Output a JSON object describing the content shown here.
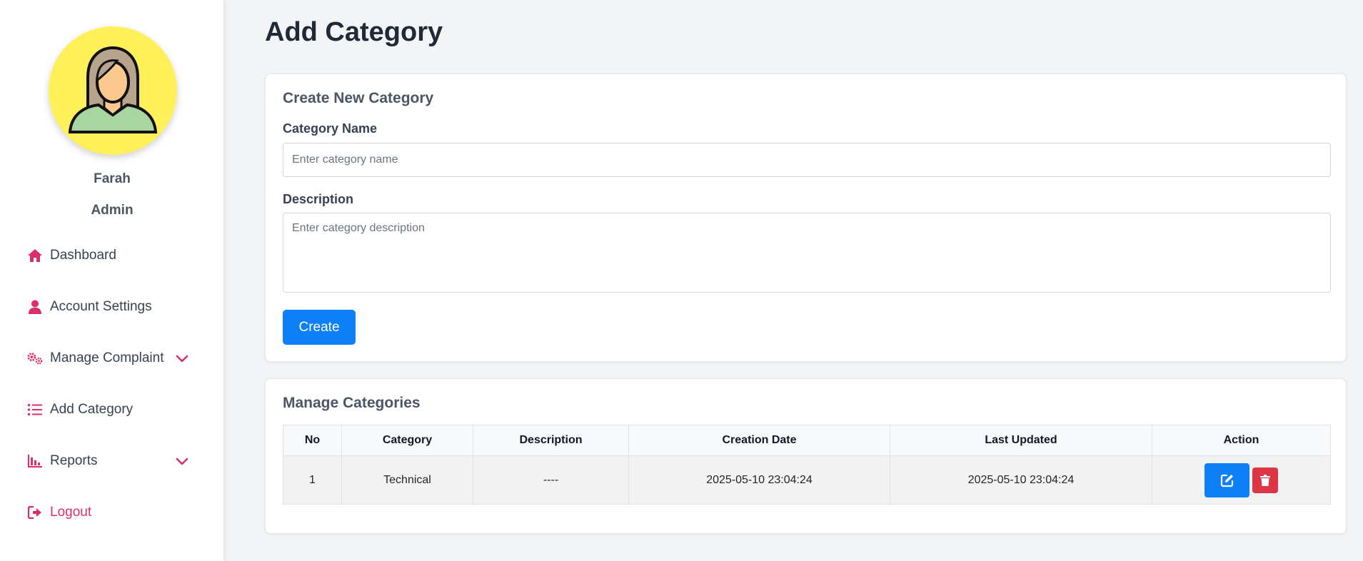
{
  "user": {
    "name": "Farah",
    "role": "Admin"
  },
  "nav": {
    "items": [
      {
        "label": "Dashboard",
        "icon": "home-icon"
      },
      {
        "label": "Account Settings",
        "icon": "user-icon"
      },
      {
        "label": "Manage Complaint",
        "icon": "cogs-icon",
        "has_submenu": true
      },
      {
        "label": "Add Category",
        "icon": "list-icon"
      },
      {
        "label": "Reports",
        "icon": "chart-icon",
        "has_submenu": true
      },
      {
        "label": "Logout",
        "icon": "logout-icon"
      }
    ]
  },
  "page": {
    "title": "Add Category"
  },
  "create_form": {
    "title": "Create New Category",
    "name_label": "Category Name",
    "name_placeholder": "Enter category name",
    "name_value": "",
    "description_label": "Description",
    "description_placeholder": "Enter category description",
    "description_value": "",
    "submit_label": "Create"
  },
  "manage": {
    "title": "Manage Categories",
    "columns": [
      "No",
      "Category",
      "Description",
      "Creation Date",
      "Last Updated",
      "Action"
    ],
    "rows": [
      {
        "no": "1",
        "category": "Technical",
        "description": "----",
        "created": "2025-05-10 23:04:24",
        "updated": "2025-05-10 23:04:24"
      }
    ]
  },
  "colors": {
    "accent_pink": "#db2f6b",
    "primary_blue": "#0d7ff7",
    "danger_red": "#dc3545",
    "avatar_bg": "#fff05a"
  }
}
